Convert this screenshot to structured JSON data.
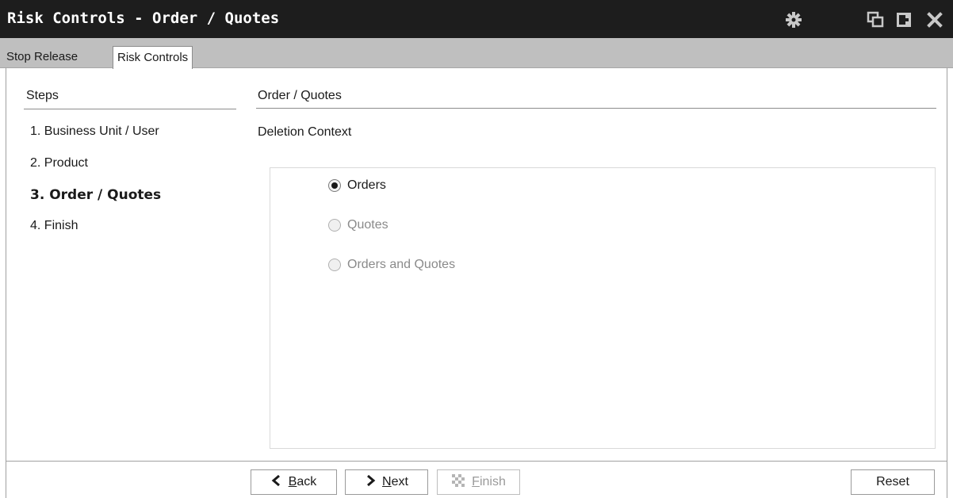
{
  "window": {
    "title": "Risk Controls - Order / Quotes",
    "icons": [
      "gear-icon",
      "restore-icon",
      "dock-icon",
      "close-icon"
    ]
  },
  "tabs": [
    {
      "label": "Stop Release",
      "active": false
    },
    {
      "label": "Risk Controls",
      "active": true
    }
  ],
  "steps": {
    "heading": "Steps",
    "items": [
      {
        "label": "1.  Business Unit / User"
      },
      {
        "label": "2.  Product"
      },
      {
        "label": "3.  Order / Quotes"
      },
      {
        "label": "4.  Finish"
      }
    ],
    "current_index": 2
  },
  "main": {
    "heading": "Order / Quotes",
    "context_label": "Deletion Context",
    "options": [
      {
        "label": "Orders",
        "checked": true,
        "enabled": true
      },
      {
        "label": "Quotes",
        "checked": false,
        "enabled": false
      },
      {
        "label": "Orders and Quotes",
        "checked": false,
        "enabled": false
      }
    ]
  },
  "buttons": {
    "back": {
      "prefix": "",
      "mnemonic": "B",
      "rest": "ack"
    },
    "next": {
      "prefix": "",
      "mnemonic": "N",
      "rest": "ext"
    },
    "finish": {
      "prefix": "",
      "mnemonic": "F",
      "rest": "inish"
    },
    "reset": "Reset"
  },
  "colors": {
    "titlebar": "#1d1d1d",
    "tabstrip": "#bfbfbf",
    "disabled_text": "#8a8a8a"
  }
}
